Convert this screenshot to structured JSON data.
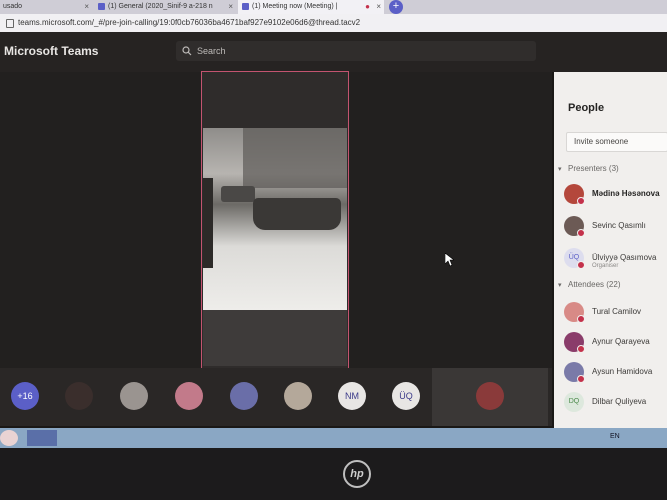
{
  "browser": {
    "tabs": [
      {
        "title": "usado"
      },
      {
        "title": "(1) General (2020_Sinif-9 a-218 n"
      },
      {
        "title": "(1) Meeting now (Meeting) |"
      }
    ],
    "url": "teams.microsoft.com/_#/pre-join-calling/19:0f0cb76036ba4671baf927e9102e06d6@thread.tacv2"
  },
  "teams": {
    "brand": "Microsoft Teams",
    "search_placeholder": "Search"
  },
  "people": {
    "title": "People",
    "invite_placeholder": "Invite someone",
    "presenters_label": "Presenters",
    "presenters_count": "(3)",
    "presenters": [
      {
        "name": "Mədinə Həsənova",
        "role": ""
      },
      {
        "name": "Sevinc Qasımlı",
        "role": ""
      },
      {
        "name": "Ülviyyə Qasımova",
        "role": "Organiser",
        "initials": "ÜQ"
      }
    ],
    "attendees_label": "Attendees",
    "attendees_count": "(22)",
    "attendees": [
      {
        "name": "Tural Camilov"
      },
      {
        "name": "Aynur Qarayeva"
      },
      {
        "name": "Aysun Hamidova"
      },
      {
        "name": "Dilbar Quliyeva",
        "initials": "DQ"
      }
    ]
  },
  "strip": {
    "overflow_count": "+16",
    "initials": [
      "NM",
      "ÜQ"
    ]
  },
  "taskbar": {
    "lang": "EN"
  },
  "brand_logo": "hp",
  "colors": {
    "accent": "#5b5fc7",
    "busy": "#c4314b",
    "frame": "#c35470"
  }
}
